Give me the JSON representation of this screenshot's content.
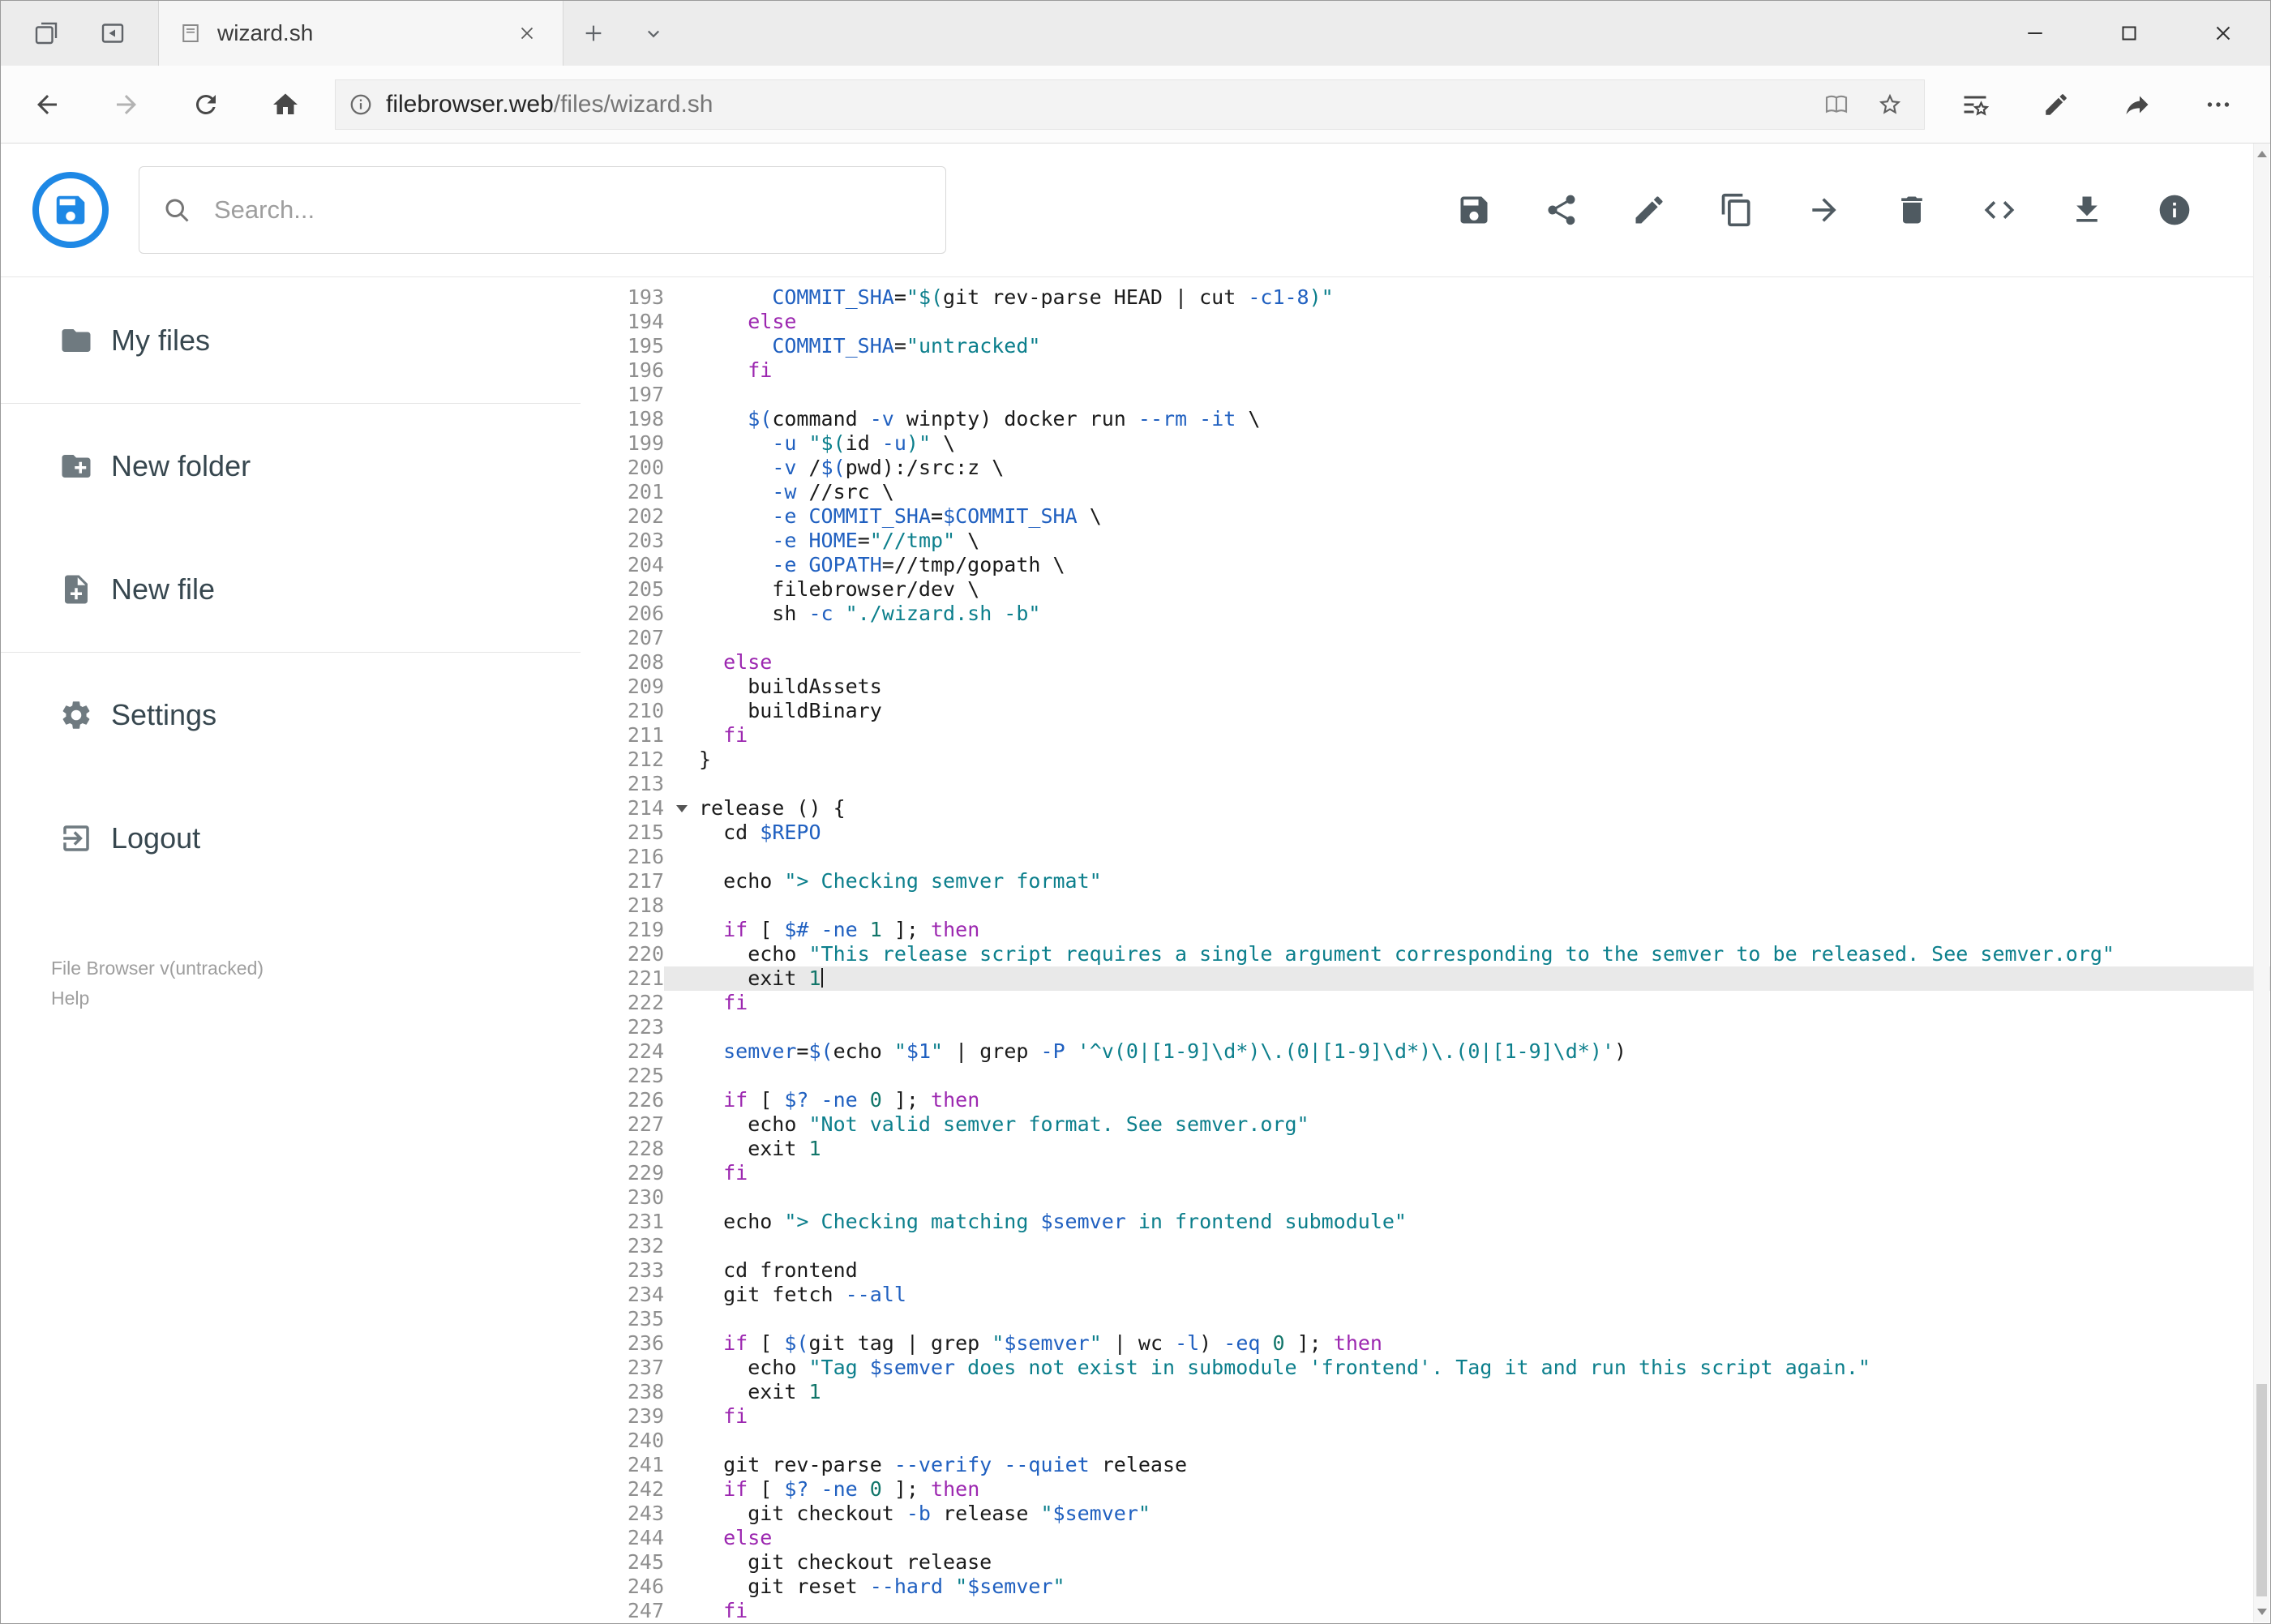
{
  "browser": {
    "tab_title": "wizard.sh",
    "url": {
      "host": "filebrowser.web",
      "path": "/files/wizard.sh"
    }
  },
  "app": {
    "search_placeholder": "Search...",
    "toolbar_icons": [
      "save",
      "share",
      "edit",
      "copy",
      "move",
      "delete",
      "raw",
      "download",
      "info"
    ],
    "sidebar": {
      "items": [
        {
          "label": "My files",
          "icon": "folder"
        },
        {
          "label": "New folder",
          "icon": "create-new-folder"
        },
        {
          "label": "New file",
          "icon": "note-add"
        },
        {
          "label": "Settings",
          "icon": "gear"
        },
        {
          "label": "Logout",
          "icon": "exit-to-app"
        }
      ],
      "footer_version": "File Browser v(untracked)",
      "footer_help": "Help"
    }
  },
  "editor": {
    "active_line": 221,
    "folded_marker_line": 214,
    "colors": {
      "keyword": "#9c27b0",
      "string": "#0c7f8c",
      "variable": "#2060c0",
      "number": "#12766a",
      "plain": "#1a1a1a"
    },
    "lines": [
      {
        "n": 193,
        "t": [
          [
            "p",
            "      "
          ],
          [
            "v",
            "COMMIT_SHA"
          ],
          [
            "p",
            "="
          ],
          [
            "s",
            "\"$("
          ],
          [
            "p",
            "git rev-parse HEAD | cut "
          ],
          [
            "v",
            "-c1-8"
          ],
          [
            "s",
            ")\""
          ]
        ]
      },
      {
        "n": 194,
        "t": [
          [
            "p",
            "    "
          ],
          [
            "k",
            "else"
          ]
        ]
      },
      {
        "n": 195,
        "t": [
          [
            "p",
            "      "
          ],
          [
            "v",
            "COMMIT_SHA"
          ],
          [
            "p",
            "="
          ],
          [
            "s",
            "\"untracked\""
          ]
        ]
      },
      {
        "n": 196,
        "t": [
          [
            "p",
            "    "
          ],
          [
            "k",
            "fi"
          ]
        ]
      },
      {
        "n": 197,
        "t": []
      },
      {
        "n": 198,
        "t": [
          [
            "p",
            "    "
          ],
          [
            "v",
            "$("
          ],
          [
            "p",
            "command "
          ],
          [
            "v",
            "-v"
          ],
          [
            "p",
            " winpty) docker run "
          ],
          [
            "v",
            "--rm"
          ],
          [
            "p",
            " "
          ],
          [
            "v",
            "-it"
          ],
          [
            "p",
            " \\"
          ]
        ]
      },
      {
        "n": 199,
        "t": [
          [
            "p",
            "      "
          ],
          [
            "v",
            "-u"
          ],
          [
            "p",
            " "
          ],
          [
            "s",
            "\"$("
          ],
          [
            "p",
            "id "
          ],
          [
            "v",
            "-u"
          ],
          [
            "s",
            ")\""
          ],
          [
            "p",
            " \\"
          ]
        ]
      },
      {
        "n": 200,
        "t": [
          [
            "p",
            "      "
          ],
          [
            "v",
            "-v"
          ],
          [
            "p",
            " /"
          ],
          [
            "v",
            "$("
          ],
          [
            "p",
            "pwd):/src:z \\"
          ]
        ]
      },
      {
        "n": 201,
        "t": [
          [
            "p",
            "      "
          ],
          [
            "v",
            "-w"
          ],
          [
            "p",
            " //src \\"
          ]
        ]
      },
      {
        "n": 202,
        "t": [
          [
            "p",
            "      "
          ],
          [
            "v",
            "-e"
          ],
          [
            "p",
            " "
          ],
          [
            "v",
            "COMMIT_SHA"
          ],
          [
            "p",
            "="
          ],
          [
            "v",
            "$COMMIT_SHA"
          ],
          [
            "p",
            " \\"
          ]
        ]
      },
      {
        "n": 203,
        "t": [
          [
            "p",
            "      "
          ],
          [
            "v",
            "-e"
          ],
          [
            "p",
            " "
          ],
          [
            "v",
            "HOME"
          ],
          [
            "p",
            "="
          ],
          [
            "s",
            "\"//tmp\""
          ],
          [
            "p",
            " \\"
          ]
        ]
      },
      {
        "n": 204,
        "t": [
          [
            "p",
            "      "
          ],
          [
            "v",
            "-e"
          ],
          [
            "p",
            " "
          ],
          [
            "v",
            "GOPATH"
          ],
          [
            "p",
            "=//tmp/gopath \\"
          ]
        ]
      },
      {
        "n": 205,
        "t": [
          [
            "p",
            "      filebrowser/dev \\"
          ]
        ]
      },
      {
        "n": 206,
        "t": [
          [
            "p",
            "      sh "
          ],
          [
            "v",
            "-c"
          ],
          [
            "p",
            " "
          ],
          [
            "s",
            "\"./wizard.sh -b\""
          ]
        ]
      },
      {
        "n": 207,
        "t": []
      },
      {
        "n": 208,
        "t": [
          [
            "p",
            "  "
          ],
          [
            "k",
            "else"
          ]
        ]
      },
      {
        "n": 209,
        "t": [
          [
            "p",
            "    buildAssets"
          ]
        ]
      },
      {
        "n": 210,
        "t": [
          [
            "p",
            "    buildBinary"
          ]
        ]
      },
      {
        "n": 211,
        "t": [
          [
            "p",
            "  "
          ],
          [
            "k",
            "fi"
          ]
        ]
      },
      {
        "n": 212,
        "t": [
          [
            "p",
            "}"
          ]
        ]
      },
      {
        "n": 213,
        "t": []
      },
      {
        "n": 214,
        "t": [
          [
            "p",
            "release () {"
          ]
        ]
      },
      {
        "n": 215,
        "t": [
          [
            "p",
            "  cd "
          ],
          [
            "v",
            "$REPO"
          ]
        ]
      },
      {
        "n": 216,
        "t": []
      },
      {
        "n": 217,
        "t": [
          [
            "p",
            "  echo "
          ],
          [
            "s",
            "\"> Checking semver format\""
          ]
        ]
      },
      {
        "n": 218,
        "t": []
      },
      {
        "n": 219,
        "t": [
          [
            "p",
            "  "
          ],
          [
            "k",
            "if"
          ],
          [
            "p",
            " [ "
          ],
          [
            "v",
            "$#"
          ],
          [
            "p",
            " "
          ],
          [
            "v",
            "-ne"
          ],
          [
            "p",
            " "
          ],
          [
            "n",
            "1"
          ],
          [
            "p",
            " ]; "
          ],
          [
            "k",
            "then"
          ]
        ]
      },
      {
        "n": 220,
        "t": [
          [
            "p",
            "    echo "
          ],
          [
            "s",
            "\"This release script requires a single argument corresponding to the semver to be released. See semver.org\""
          ]
        ]
      },
      {
        "n": 221,
        "t": [
          [
            "p",
            "    exit "
          ],
          [
            "n",
            "1"
          ]
        ]
      },
      {
        "n": 222,
        "t": [
          [
            "p",
            "  "
          ],
          [
            "k",
            "fi"
          ]
        ]
      },
      {
        "n": 223,
        "t": []
      },
      {
        "n": 224,
        "t": [
          [
            "p",
            "  "
          ],
          [
            "v",
            "semver"
          ],
          [
            "p",
            "="
          ],
          [
            "v",
            "$("
          ],
          [
            "p",
            "echo "
          ],
          [
            "s",
            "\""
          ],
          [
            "v",
            "$1"
          ],
          [
            "s",
            "\""
          ],
          [
            "p",
            " | grep "
          ],
          [
            "v",
            "-P"
          ],
          [
            "p",
            " "
          ],
          [
            "s",
            "'^v(0|[1-9]\\d*)\\.(0|[1-9]\\d*)\\.(0|[1-9]\\d*)'"
          ],
          [
            "p",
            ")"
          ]
        ]
      },
      {
        "n": 225,
        "t": []
      },
      {
        "n": 226,
        "t": [
          [
            "p",
            "  "
          ],
          [
            "k",
            "if"
          ],
          [
            "p",
            " [ "
          ],
          [
            "v",
            "$?"
          ],
          [
            "p",
            " "
          ],
          [
            "v",
            "-ne"
          ],
          [
            "p",
            " "
          ],
          [
            "n",
            "0"
          ],
          [
            "p",
            " ]; "
          ],
          [
            "k",
            "then"
          ]
        ]
      },
      {
        "n": 227,
        "t": [
          [
            "p",
            "    echo "
          ],
          [
            "s",
            "\"Not valid semver format. See semver.org\""
          ]
        ]
      },
      {
        "n": 228,
        "t": [
          [
            "p",
            "    exit "
          ],
          [
            "n",
            "1"
          ]
        ]
      },
      {
        "n": 229,
        "t": [
          [
            "p",
            "  "
          ],
          [
            "k",
            "fi"
          ]
        ]
      },
      {
        "n": 230,
        "t": []
      },
      {
        "n": 231,
        "t": [
          [
            "p",
            "  echo "
          ],
          [
            "s",
            "\"> Checking matching "
          ],
          [
            "v",
            "$semver"
          ],
          [
            "s",
            " in frontend submodule\""
          ]
        ]
      },
      {
        "n": 232,
        "t": []
      },
      {
        "n": 233,
        "t": [
          [
            "p",
            "  cd frontend"
          ]
        ]
      },
      {
        "n": 234,
        "t": [
          [
            "p",
            "  git fetch "
          ],
          [
            "v",
            "--all"
          ]
        ]
      },
      {
        "n": 235,
        "t": []
      },
      {
        "n": 236,
        "t": [
          [
            "p",
            "  "
          ],
          [
            "k",
            "if"
          ],
          [
            "p",
            " [ "
          ],
          [
            "v",
            "$("
          ],
          [
            "p",
            "git tag | grep "
          ],
          [
            "s",
            "\""
          ],
          [
            "v",
            "$semver"
          ],
          [
            "s",
            "\""
          ],
          [
            "p",
            " | wc "
          ],
          [
            "v",
            "-l"
          ],
          [
            "p",
            ") "
          ],
          [
            "v",
            "-eq"
          ],
          [
            "p",
            " "
          ],
          [
            "n",
            "0"
          ],
          [
            "p",
            " ]; "
          ],
          [
            "k",
            "then"
          ]
        ]
      },
      {
        "n": 237,
        "t": [
          [
            "p",
            "    echo "
          ],
          [
            "s",
            "\"Tag "
          ],
          [
            "v",
            "$semver"
          ],
          [
            "s",
            " does not exist in submodule 'frontend'. Tag it and run this script again.\""
          ]
        ]
      },
      {
        "n": 238,
        "t": [
          [
            "p",
            "    exit "
          ],
          [
            "n",
            "1"
          ]
        ]
      },
      {
        "n": 239,
        "t": [
          [
            "p",
            "  "
          ],
          [
            "k",
            "fi"
          ]
        ]
      },
      {
        "n": 240,
        "t": []
      },
      {
        "n": 241,
        "t": [
          [
            "p",
            "  git rev-parse "
          ],
          [
            "v",
            "--verify"
          ],
          [
            "p",
            " "
          ],
          [
            "v",
            "--quiet"
          ],
          [
            "p",
            " release"
          ]
        ]
      },
      {
        "n": 242,
        "t": [
          [
            "p",
            "  "
          ],
          [
            "k",
            "if"
          ],
          [
            "p",
            " [ "
          ],
          [
            "v",
            "$?"
          ],
          [
            "p",
            " "
          ],
          [
            "v",
            "-ne"
          ],
          [
            "p",
            " "
          ],
          [
            "n",
            "0"
          ],
          [
            "p",
            " ]; "
          ],
          [
            "k",
            "then"
          ]
        ]
      },
      {
        "n": 243,
        "t": [
          [
            "p",
            "    git checkout "
          ],
          [
            "v",
            "-b"
          ],
          [
            "p",
            " release "
          ],
          [
            "s",
            "\""
          ],
          [
            "v",
            "$semver"
          ],
          [
            "s",
            "\""
          ]
        ]
      },
      {
        "n": 244,
        "t": [
          [
            "p",
            "  "
          ],
          [
            "k",
            "else"
          ]
        ]
      },
      {
        "n": 245,
        "t": [
          [
            "p",
            "    git checkout release"
          ]
        ]
      },
      {
        "n": 246,
        "t": [
          [
            "p",
            "    git reset "
          ],
          [
            "v",
            "--hard"
          ],
          [
            "p",
            " "
          ],
          [
            "s",
            "\""
          ],
          [
            "v",
            "$semver"
          ],
          [
            "s",
            "\""
          ]
        ]
      },
      {
        "n": 247,
        "t": [
          [
            "p",
            "  "
          ],
          [
            "k",
            "fi"
          ]
        ]
      }
    ]
  }
}
